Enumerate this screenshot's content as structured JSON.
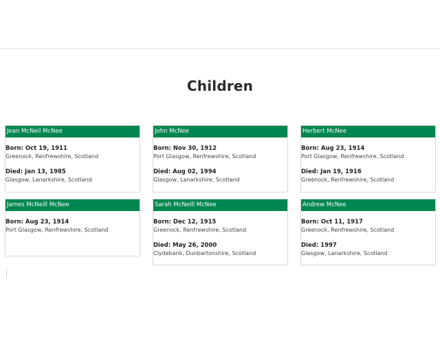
{
  "section": {
    "title": "Children"
  },
  "children": [
    {
      "name": "Jean McNeil McNee",
      "born_label": "Born: Oct 19, 1911",
      "born_place": "Greenock, Renfrewshire, Scotland",
      "died_label": "Died: Jan 13, 1985",
      "died_place": "Glasgow, Lanarkshire, Scotland"
    },
    {
      "name": "John McNee",
      "born_label": "Born: Nov 30, 1912",
      "born_place": "Port Glasgow, Renfrewshire, Scotland",
      "died_label": "Died: Aug 02, 1994",
      "died_place": "Glasgow, Lanarkshire, Scotland"
    },
    {
      "name": "Herbert McNee",
      "born_label": "Born: Aug 23, 1914",
      "born_place": "Port Glasgow, Renfrewshire, Scotland",
      "died_label": "Died: Jan 19, 1916",
      "died_place": "Greenock, Renfrewshire, Scotland"
    },
    {
      "name": "James McNeill McNee",
      "born_label": "Born: Aug 23, 1914",
      "born_place": "Port Glasgow, Renfrewshire, Scotland"
    },
    {
      "name": "Sarah McNeill McNee",
      "born_label": "Born: Dec 12, 1915",
      "born_place": "Greenock, Renfrewshire, Scotland",
      "died_label": "Died: May 26, 2000",
      "died_place": "Clydebank, Dunbartonshire, Scotland"
    },
    {
      "name": "Andrew McNee",
      "born_label": "Born: Oct 11, 1917",
      "born_place": "Greenock, Renfrewshire, Scotland",
      "died_label": "Died: 1997",
      "died_place": "Glasgow, Lanarkshire, Scotland"
    }
  ],
  "colors": {
    "header_bg": "#00874f",
    "header_text": "#ffffff"
  }
}
